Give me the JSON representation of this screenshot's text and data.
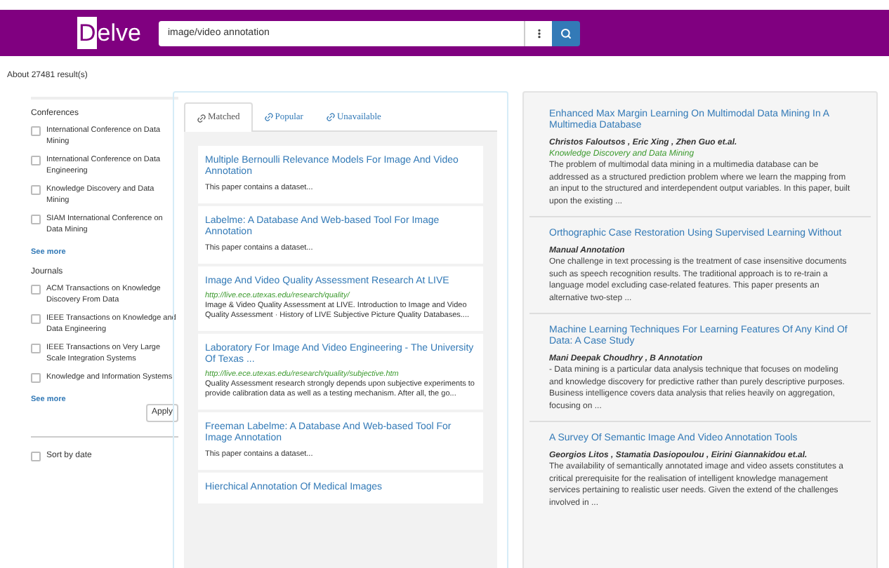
{
  "header": {
    "logo_first": "D",
    "logo_rest": "elve",
    "search": {
      "value": "image/video annotation"
    }
  },
  "result_count": "About 27481 result(s)",
  "filters": {
    "groups": [
      {
        "title": "Conferences",
        "items": [
          {
            "label": "International Conference on Data Mining",
            "checked": false
          },
          {
            "label": "International Conference on Data Engineering",
            "checked": false
          },
          {
            "label": "Knowledge Discovery and Data Mining",
            "checked": false
          },
          {
            "label": "SIAM International Conference on Data Mining",
            "checked": false
          }
        ],
        "see_more": "See more"
      },
      {
        "title": "Journals",
        "items": [
          {
            "label": "ACM Transactions on Knowledge Discovery From Data",
            "checked": false
          },
          {
            "label": "IEEE Transactions on Knowledge and Data Engineering",
            "checked": false
          },
          {
            "label": "IEEE Transactions on Very Large Scale Integration Systems",
            "checked": false
          },
          {
            "label": "Knowledge and Information Systems",
            "checked": false
          }
        ],
        "see_more": "See more"
      }
    ],
    "apply": "Apply",
    "sort": {
      "label": "Sort by date",
      "checked": false
    }
  },
  "tabs": [
    {
      "label": "Matched",
      "selected": true
    },
    {
      "label": "Popular",
      "selected": false
    },
    {
      "label": "Unavailable",
      "selected": false
    }
  ],
  "datasets": [
    {
      "title": "Multiple Bernoulli Relevance Models For Image And Video Annotation",
      "snippet": "This paper contains a dataset..."
    },
    {
      "title": "Labelme: A Database And Web-based Tool For Image Annotation",
      "snippet": "This paper contains a dataset..."
    },
    {
      "title": "Image And Video Quality Assessment Research At LIVE",
      "url": "http://live.ece.utexas.edu/research/quality/",
      "snippet": "Image & Video Quality Assessment at LIVE. Introduction to Image and Video Quality Assessment · History of LIVE Subjective Picture Quality Databases...."
    },
    {
      "title": "Laboratory For Image And Video Engineering - The University Of Texas ...",
      "url": "http://live.ece.utexas.edu/research/quality/subjective.htm",
      "snippet": "Quality Assessment research strongly depends upon subjective experiments to provide calibration data as well as a testing mechanism. After all, the go..."
    },
    {
      "title": "Freeman Labelme: A Database And Web-based Tool For Image Annotation",
      "snippet": "This paper contains a dataset..."
    },
    {
      "title": "Hierchical Annotation Of Medical Images"
    }
  ],
  "papers": [
    {
      "title": "Enhanced Max Margin Learning On Multimodal Data Mining In A Multimedia Database",
      "authors": "Christos Faloutsos , Eric Xing , Zhen Guo et.al.",
      "venue": "Knowledge Discovery and Data Mining",
      "abstract": "The problem of multimodal data mining in a multimedia database can be addressed as a structured prediction problem where we learn the mapping from an input to the structured and interdependent output variables. In this paper, built upon the existing ..."
    },
    {
      "title": "Orthographic Case Restoration Using Supervised Learning Without",
      "authors": "Manual Annotation",
      "abstract": "One challenge in text processing is the treatment of case insensitive documents such as speech recognition results. The traditional approach is to re-train a language model excluding case-related features. This paper presents an alternative two-step ..."
    },
    {
      "title": "Machine Learning Techniques For Learning Features Of Any Kind Of Data: A Case Study",
      "authors": "Mani Deepak Choudhry , B Annotation",
      "abstract": "- Data mining is a particular data analysis technique that focuses on modeling and knowledge discovery for predictive rather than purely descriptive purposes. Business intelligence covers data analysis that relies heavily on aggregation, focusing on ..."
    },
    {
      "title": "A Survey Of Semantic Image And Video Annotation Tools",
      "authors": "Georgios Litos , Stamatia Dasiopoulou , Eirini Giannakidou et.al.",
      "abstract": "The availability of semantically annotated image and video assets constitutes a critical prerequisite for the realisation of intelligent knowledge management services pertaining to realistic user needs. Given the extend of the challenges involved in ..."
    }
  ]
}
